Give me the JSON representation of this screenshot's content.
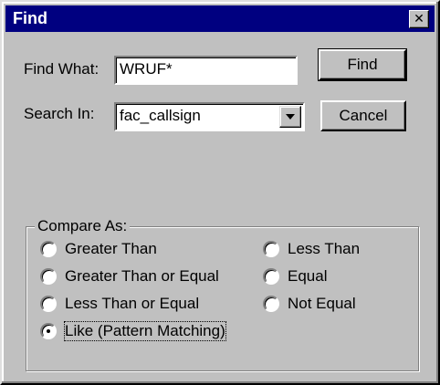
{
  "window": {
    "title": "Find",
    "close_glyph": "✕"
  },
  "find_what": {
    "label": "Find What:",
    "value": "WRUF*"
  },
  "search_in": {
    "label": "Search In:",
    "selected": "fac_callsign"
  },
  "buttons": {
    "find": "Find",
    "cancel": "Cancel"
  },
  "compare_as": {
    "caption": "Compare As:",
    "options": [
      {
        "label": "Greater Than",
        "checked": false
      },
      {
        "label": "Greater Than or Equal",
        "checked": false
      },
      {
        "label": "Less Than or Equal",
        "checked": false
      },
      {
        "label": "Like (Pattern Matching)",
        "checked": true
      },
      {
        "label": "Less Than",
        "checked": false
      },
      {
        "label": "Equal",
        "checked": false
      },
      {
        "label": "Not Equal",
        "checked": false
      }
    ]
  },
  "colors": {
    "title_bar": "#000080",
    "face": "#c0c0c0"
  }
}
